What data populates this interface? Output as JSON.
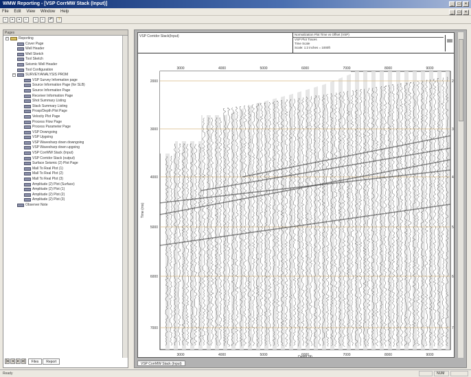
{
  "window": {
    "title": "WMW Reporting - [VSP CorrMW Stack (Input)]",
    "buttons": [
      "_",
      "□",
      "×"
    ],
    "doc_buttons": [
      "_",
      "□",
      "×"
    ]
  },
  "menu": [
    "File",
    "Edit",
    "View",
    "Window",
    "Help"
  ],
  "toolbar": {
    "icons": [
      "new-icon",
      "open-icon",
      "save-icon",
      "print-icon",
      "copy-icon",
      "paste-icon",
      "undo-icon",
      "help-icon"
    ]
  },
  "left_pane": {
    "caption": "Pages",
    "tree": [
      {
        "label": "Reporting",
        "level": 0,
        "expander": "−",
        "icon": "folder"
      },
      {
        "label": "Cover Page",
        "level": 1
      },
      {
        "label": "Well Header",
        "level": 1
      },
      {
        "label": "Well Sketch",
        "level": 1
      },
      {
        "label": "Tool Sketch",
        "level": 1
      },
      {
        "label": "Seismic Well Header",
        "level": 1
      },
      {
        "label": "Tool Configuration",
        "level": 1
      },
      {
        "label": "SURVEY/ANALYSIS PROM",
        "level": 1,
        "expander": "−"
      },
      {
        "label": "VSP Survey Information page",
        "level": 2
      },
      {
        "label": "Source Information Page (for SLB)",
        "level": 2
      },
      {
        "label": "Source Information Page",
        "level": 2
      },
      {
        "label": "Receiver Information Page",
        "level": 2
      },
      {
        "label": "Shot Summary Listing",
        "level": 2
      },
      {
        "label": "Stack Summary Listing",
        "level": 2
      },
      {
        "label": "Prosp/Depth Plot Page",
        "level": 2
      },
      {
        "label": "Velocity Plot Page",
        "level": 2
      },
      {
        "label": "Process Flow Page",
        "level": 2
      },
      {
        "label": "Process Parameter Page",
        "level": 2
      },
      {
        "label": "VSP Downgoing",
        "level": 2
      },
      {
        "label": "VSP Upgoing",
        "level": 2
      },
      {
        "label": "VSP Wavesharp down downgoing",
        "level": 2
      },
      {
        "label": "VSP Wavesharp down upgoing",
        "level": 2
      },
      {
        "label": "VSP CorrMW Stack (Input)",
        "level": 2
      },
      {
        "label": "VSP Corridor Stack (output)",
        "level": 2
      },
      {
        "label": "Surface Seismic (2) Plot Page",
        "level": 2
      },
      {
        "label": "Mall To Real Plot (1)",
        "level": 2
      },
      {
        "label": "Mall To Real Plot (2)",
        "level": 2
      },
      {
        "label": "Mall To Real Plot (3)",
        "level": 2
      },
      {
        "label": "Amplitude (2) Plot (Surface)",
        "level": 2
      },
      {
        "label": "Amplitude (2) Plot (1)",
        "level": 2
      },
      {
        "label": "Amplitude (2) Plot (2)",
        "level": 2
      },
      {
        "label": "Amplitude (2) Plot (3)",
        "level": 2
      },
      {
        "label": "Observer Note",
        "level": 1
      }
    ],
    "tabs": [
      "Files",
      "Report"
    ]
  },
  "document": {
    "header_left": "VSP Corridor Stack(Input)",
    "header_lines": [
      "Normalization Plot  Time vs Offset  (VSP)",
      "VSP  Plot  Traces",
      "Time Scale",
      "Scale: 1:2 inches = 1000ft"
    ],
    "tab": "VSP CorrMW Stack (Input)"
  },
  "chart_data": {
    "type": "seismic-wiggle-section",
    "x_ticks": [
      "3000",
      "4000",
      "5000",
      "6000",
      "7000",
      "8000",
      "9000"
    ],
    "x_ticks_top": [
      "3000",
      "4000",
      "5000",
      "6000",
      "7000",
      "8000",
      "9000"
    ],
    "y_ticks_left": [
      "2000",
      "3000",
      "4000",
      "5000",
      "6000",
      "7000"
    ],
    "y_ticks_right": [
      "2000",
      "3000",
      "4000",
      "5000",
      "6000",
      "7000"
    ],
    "xlabel": "Depth (ft)",
    "ylabel": "Time (ms)",
    "grid": "horizontal",
    "grid_color": "#d8b880",
    "trace_color": "#222222"
  },
  "status": {
    "text": "Ready",
    "panels": [
      "",
      "NUM",
      ""
    ]
  },
  "colors": {
    "title_start": "#0a2a6e",
    "title_end": "#a8b8d8",
    "chrome": "#ece9e1",
    "workspace": "#b2b2b2"
  }
}
